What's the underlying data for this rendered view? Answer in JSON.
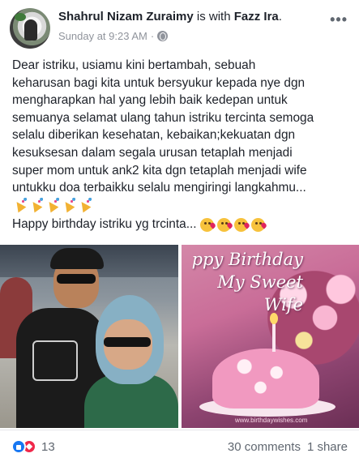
{
  "post": {
    "author": "Shahrul Nizam Zuraimy",
    "with_text": "is with",
    "tagged": "Fazz Ira",
    "tagged_suffix": ".",
    "timestamp": "Sunday at 9:23 AM",
    "separator": "·",
    "privacy_icon": "globe-icon",
    "more_label": "•••",
    "text_lines": [
      "Dear istriku, usiamu kini bertambah, sebuah",
      "keharusan bagi kita untuk bersyukur kepada nye dgn",
      "mengharapkan hal yang lebih baik kedepan untuk",
      "semuanya selamat ulang tahun istriku tercinta semoga",
      "selalu diberikan kesehatan, kebaikan;kekuatan dgn",
      "kesuksesan dalam segala urusan tetaplah menjadi",
      "super mom untuk ank2 kita dgn tetaplah menjadi wife",
      "untukku doa terbaikku selalu mengiringi langkahmu..."
    ],
    "emoji_row": [
      "party-popper-icon",
      "party-popper-icon",
      "party-popper-icon",
      "party-popper-icon",
      "party-popper-icon"
    ],
    "second_line": "Happy birthday istriku yg trcinta...",
    "second_line_emojis": [
      "kissing-face-icon",
      "kissing-face-icon",
      "kissing-face-icon",
      "kissing-face-icon"
    ]
  },
  "photos": {
    "right_card": {
      "line1": "ppy Birthday",
      "line2": "My Sweet",
      "line3": "Wife",
      "watermark": "www.birthdaywishes.com"
    }
  },
  "footer": {
    "reaction_icons": [
      "like-icon",
      "love-icon"
    ],
    "reaction_count": "13",
    "comments": "30 comments",
    "shares": "1 share"
  },
  "colors": {
    "primary_text": "#1d2129",
    "secondary_text": "#90949c",
    "like_blue": "#1877f2",
    "love_red": "#f0284a"
  }
}
